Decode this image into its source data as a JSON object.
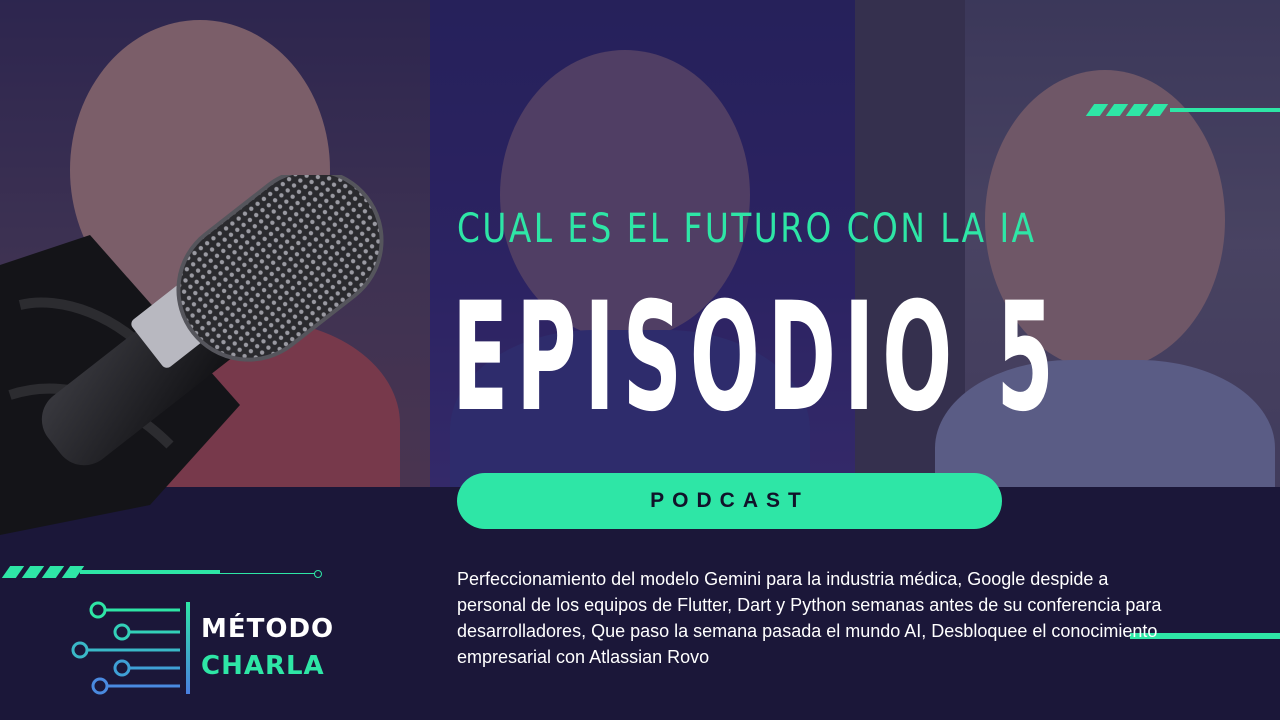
{
  "thumbnail": {
    "subtitle": "CUAL ES EL FUTURO CON LA IA",
    "title": "EPISODIO 5",
    "pill_label": "PODCAST",
    "description": "Perfeccionamiento del modelo Gemini para la industria médica,  Google despide a personal de los equipos de Flutter, Dart y Python semanas antes de su conferencia para desarrolladores, Que paso la semana pasada el mundo AI, Desbloquee el conocimiento empresarial con Atlassian Rovo"
  },
  "logo": {
    "line1": "MÉTODO",
    "line2": "CHARLA"
  },
  "colors": {
    "background": "#1b1739",
    "accent": "#2ee6a6",
    "text": "#ffffff"
  },
  "icons": [
    "microphone-icon",
    "circuit-icon"
  ]
}
